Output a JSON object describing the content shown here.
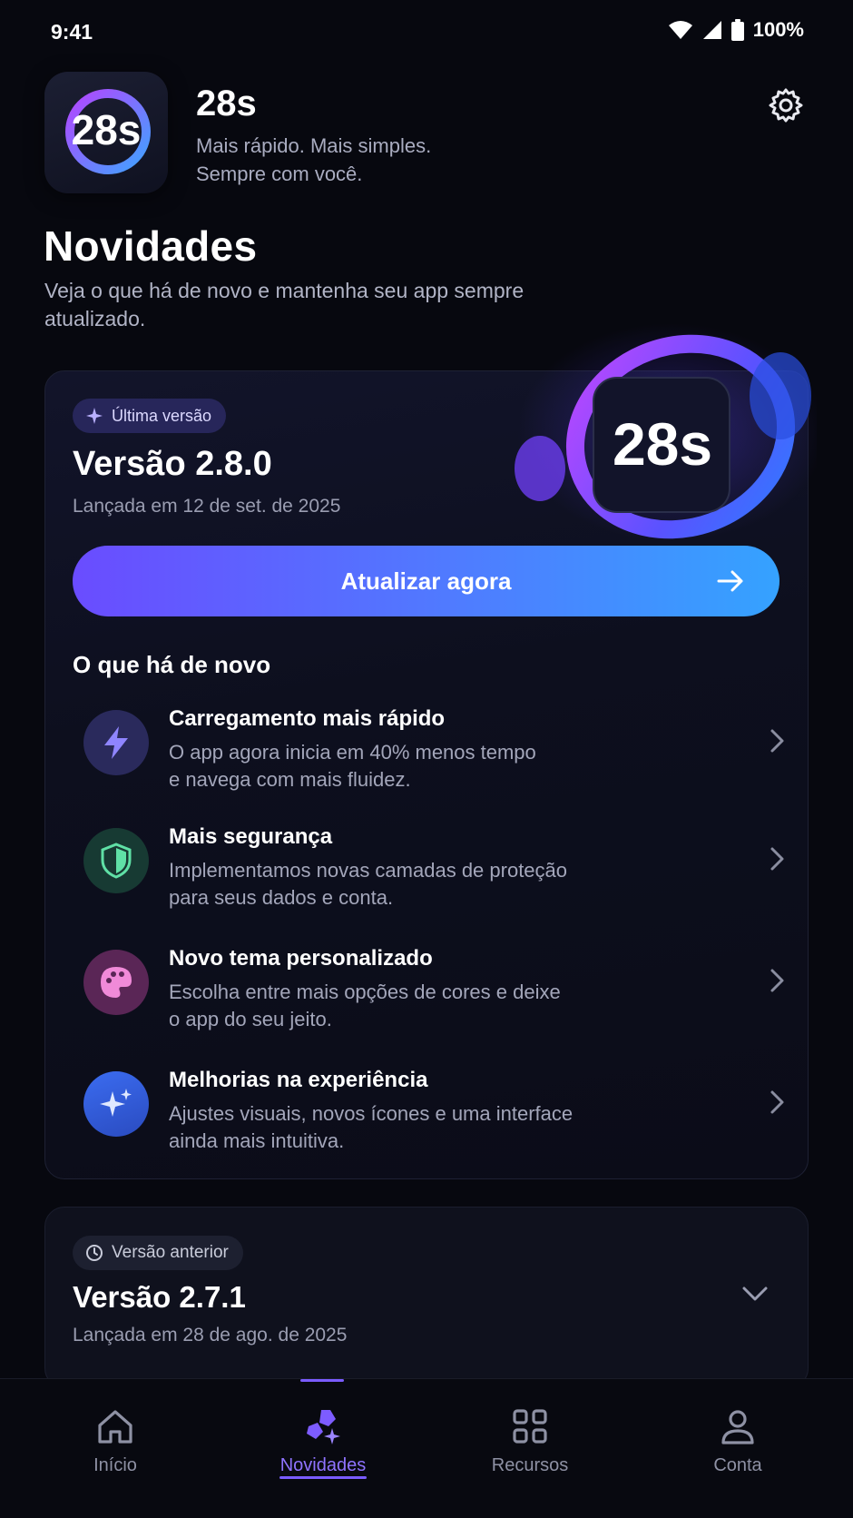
{
  "status": {
    "time": "9:41",
    "battery": "100%"
  },
  "app": {
    "name": "28s",
    "icon_text": "28s",
    "tagline_1": "Mais rápido. Mais simples.",
    "tagline_2": "Sempre com você."
  },
  "page": {
    "title": "Novidades",
    "lead": "Veja o que há de novo e mantenha seu app sempre atualizado."
  },
  "latest": {
    "badge": "Última versão",
    "version": "Versão 2.8.0",
    "date": "Lançada em 12 de set. de 2025",
    "hero_text": "28s",
    "cta": "Atualizar agora",
    "section_title": "O que há de novo",
    "features": [
      {
        "title": "Carregamento mais rápido",
        "line1": "O app agora inicia em 40% menos tempo",
        "line2": "e navega com mais fluidez.",
        "icon": "lightning-icon",
        "color": "#7c6cff"
      },
      {
        "title": "Mais segurança",
        "line1": "Implementamos novas camadas de proteção",
        "line2": "para seus dados e conta.",
        "icon": "shield-icon",
        "color": "#5fe0a6"
      },
      {
        "title": "Novo tema personalizado",
        "line1": "Escolha entre mais opções de cores e deixe",
        "line2": "o app do seu jeito.",
        "icon": "palette-icon",
        "color": "#e06acb"
      },
      {
        "title": "Melhorias na experiência",
        "line1": "Ajustes visuais, novos ícones e uma interface",
        "line2": "ainda mais intuitiva.",
        "icon": "sparkles-icon",
        "color": "#5aa0ff"
      }
    ]
  },
  "previous": {
    "badge": "Versão anterior",
    "version": "Versão 2.7.1",
    "date": "Lançada em 28 de ago. de 2025"
  },
  "nav": {
    "items": [
      {
        "label": "Início",
        "icon": "home-icon"
      },
      {
        "label": "Novidades",
        "icon": "news-icon",
        "active": true
      },
      {
        "label": "Recursos",
        "icon": "grid-icon"
      },
      {
        "label": "Conta",
        "icon": "user-icon"
      }
    ]
  },
  "colors": {
    "accent": "#7a5cff",
    "bg": "#07080f",
    "cta_start": "#6a4cff",
    "cta_end": "#35a2ff"
  }
}
